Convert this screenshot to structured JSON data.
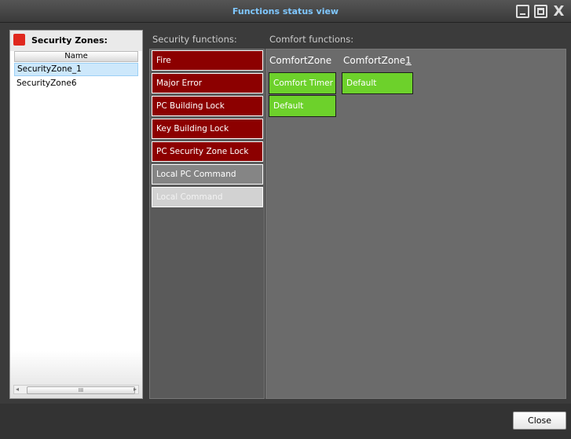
{
  "window": {
    "title": "Functions status view",
    "title_color": "#7fc7ff"
  },
  "left_panel": {
    "title": "Security Zones:",
    "status_color": "#e0281e",
    "column_header": "Name",
    "zones": [
      "SecurityZone_1",
      "SecurityZone6"
    ],
    "selected_zone": "SecurityZone_1",
    "scrollbar_thumb_glyph": "III"
  },
  "security_functions": {
    "label": "Security functions:",
    "items": [
      {
        "label": "Fire",
        "state": "red"
      },
      {
        "label": "Major Error",
        "state": "red"
      },
      {
        "label": "PC Building Lock",
        "state": "red"
      },
      {
        "label": "Key Building Lock",
        "state": "red"
      },
      {
        "label": "PC Security Zone Lock",
        "state": "red"
      },
      {
        "label": "Local PC Command",
        "state": "grey"
      },
      {
        "label": "Local Command",
        "state": "lightgrey"
      }
    ]
  },
  "comfort_functions": {
    "label": "Comfort functions:",
    "zones": [
      {
        "name": "ComfortZone",
        "items": [
          "Comfort Timer",
          "Default"
        ]
      },
      {
        "name_prefix": "ComfortZone",
        "name_underlined": "1",
        "items": [
          "Default"
        ]
      }
    ]
  },
  "colors": {
    "active_red": "#8c0000",
    "inactive_grey": "#858585",
    "disabled_grey": "#d2d2d2",
    "comfort_green": "#6dd12b"
  },
  "footer": {
    "close_label": "Close"
  }
}
